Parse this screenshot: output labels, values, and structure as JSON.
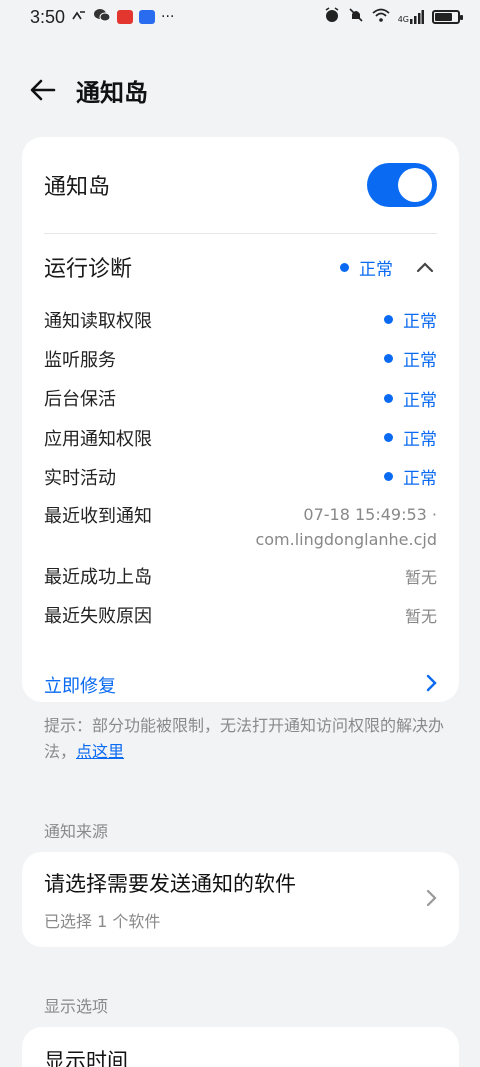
{
  "status_bar": {
    "time": "3:50",
    "icons_left": [
      "nfc-icon",
      "wechat-icon",
      "app-red-icon",
      "app-blue-icon",
      "more-dots-icon"
    ],
    "icons_right": [
      "alarm-icon",
      "mute-icon",
      "wifi-icon",
      "signal-icon",
      "battery-icon"
    ],
    "more": "···",
    "network": "4G"
  },
  "app_bar": {
    "title": "通知岛"
  },
  "main_card": {
    "toggle_label": "通知岛",
    "toggle_on": true,
    "diagnostics": {
      "label": "运行诊断",
      "status": "正常",
      "rows": [
        {
          "label": "通知读取权限",
          "value": "正常"
        },
        {
          "label": "监听服务",
          "value": "正常"
        },
        {
          "label": "后台保活",
          "value": "正常"
        },
        {
          "label": "应用通知权限",
          "value": "正常"
        },
        {
          "label": "实时活动",
          "value": "正常"
        }
      ],
      "last_notification_label": "最近收到通知",
      "last_notification_line1": "07-18 15:49:53 ·",
      "last_notification_line2": "com.lingdonglanhe.cjd",
      "last_success_label": "最近成功上岛",
      "last_success_value": "暂无",
      "last_fail_label": "最近失败原因",
      "last_fail_value": "暂无"
    },
    "fix_label": "立即修复"
  },
  "hint": {
    "prefix": "提示：部分功能被限制，无法打开通知访问权限的解决办法，",
    "link": "点这里"
  },
  "source_section": {
    "label": "通知来源",
    "title": "请选择需要发送通知的软件",
    "subtitle": "已选择 1 个软件"
  },
  "display_section": {
    "label": "显示选项",
    "first_item": "显示时间"
  },
  "colors": {
    "accent": "#0a6af2",
    "background": "#f1f3f5"
  }
}
